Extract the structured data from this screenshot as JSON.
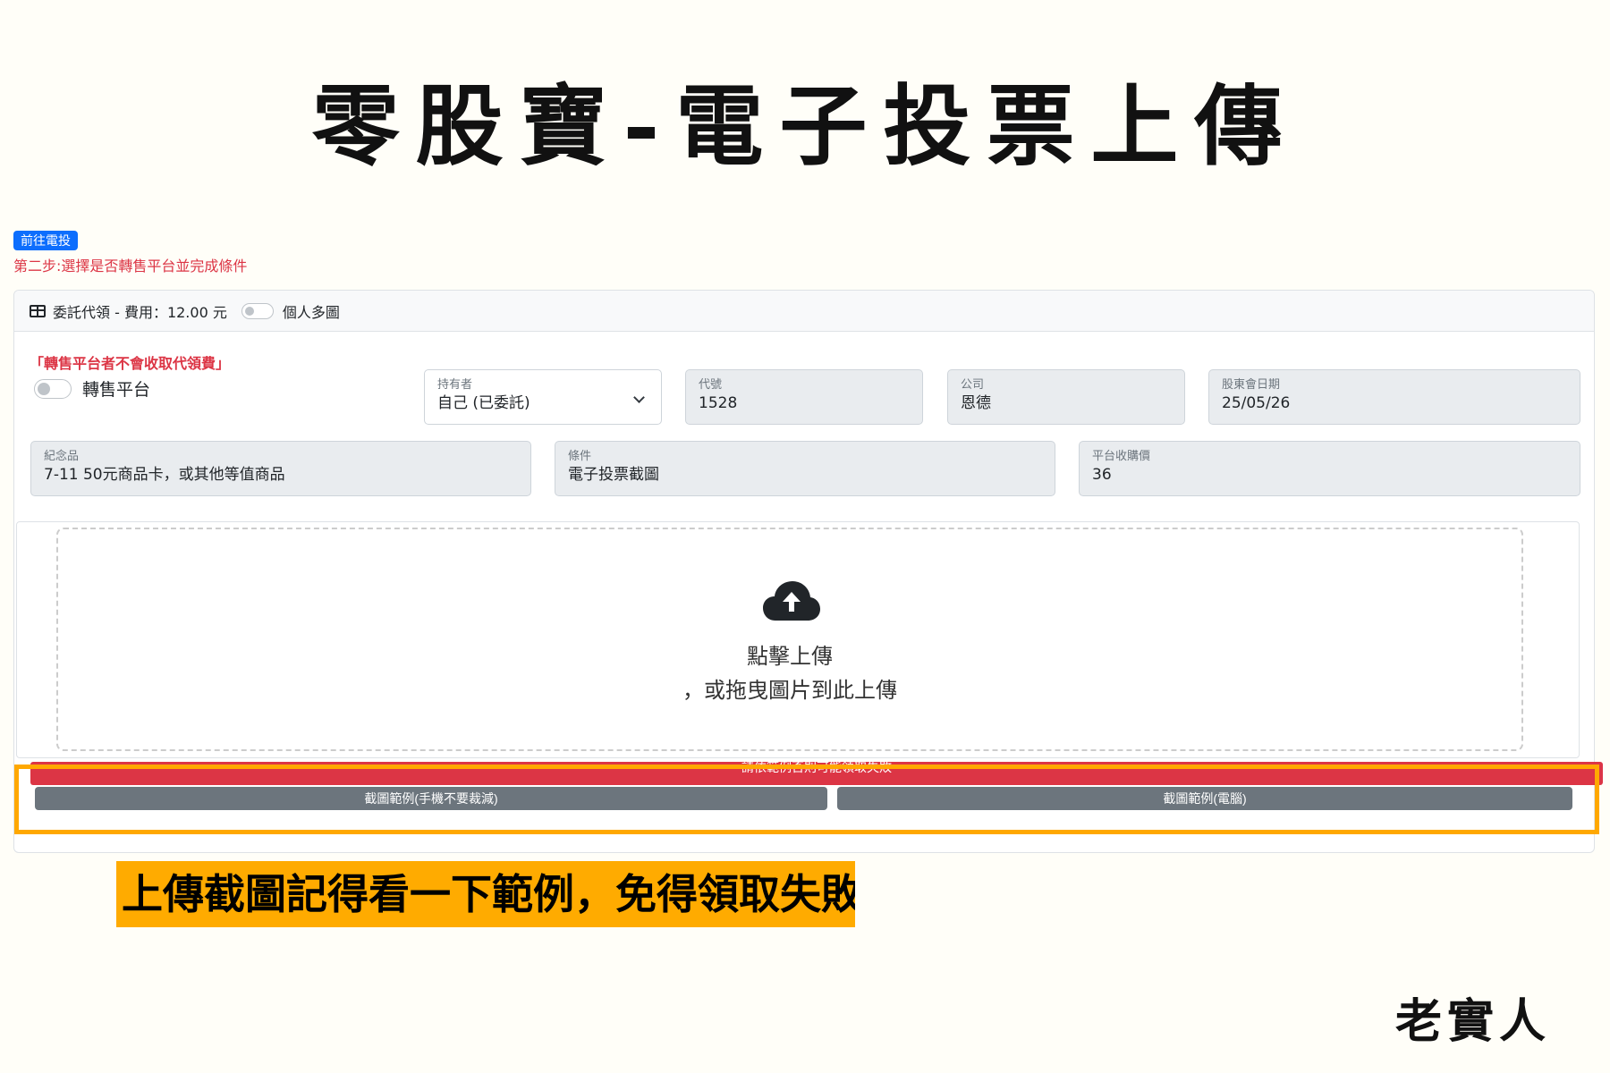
{
  "page_title": "零股寶-電子投票上傳",
  "go_vote_button": "前往電投",
  "step_text": "第二步:選擇是否轉售平台並完成條件",
  "card_header": {
    "title": "委託代領 - 費用：12.00 元",
    "multi_image_label": "個人多圖"
  },
  "resale_warning": "「轉售平台者不會收取代領費」",
  "resale_label": "轉售平台",
  "fields": {
    "holder": {
      "label": "持有者",
      "value": "自己 (已委託)"
    },
    "code": {
      "label": "代號",
      "value": "1528"
    },
    "company": {
      "label": "公司",
      "value": "恩德"
    },
    "meeting_date": {
      "label": "股東會日期",
      "value": "25/05/26"
    },
    "souvenir": {
      "label": "紀念品",
      "value": "7-11 50元商品卡，或其他等值商品"
    },
    "condition": {
      "label": "條件",
      "value": "電子投票截圖"
    },
    "buyback_price": {
      "label": "平台收購價",
      "value": "36"
    }
  },
  "upload": {
    "title": "點擊上傳",
    "subtitle": "，或拖曳圖片到此上傳"
  },
  "warning_bar": "請依範例否則可能領取失敗",
  "sample_buttons": {
    "mobile": "截圖範例(手機不要裁減)",
    "pc": "截圖範例(電腦)"
  },
  "tip_banner": "上傳截圖記得看一下範例，免得領取失敗",
  "author": "老實人",
  "colors": {
    "primary": "#0d6efd",
    "danger": "#dc3545",
    "secondary": "#6c757d",
    "highlight": "#ffa800"
  }
}
